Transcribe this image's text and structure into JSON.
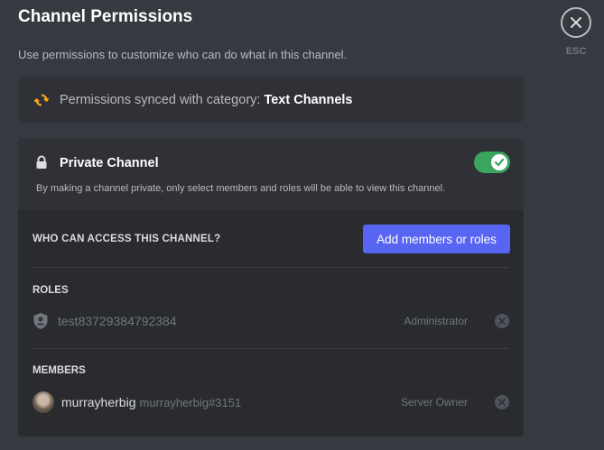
{
  "header": {
    "title": "Channel Permissions",
    "subtitle": "Use permissions to customize who can do what in this channel.",
    "esc_label": "ESC"
  },
  "sync": {
    "prefix": "Permissions synced with category: ",
    "category": "Text Channels",
    "icon": "sync-icon",
    "icon_color": "#faa61a"
  },
  "private_channel": {
    "title": "Private Channel",
    "description": "By making a channel private, only select members and roles will be able to view this channel.",
    "enabled": true,
    "toggle_color": "#3ba55d"
  },
  "access": {
    "heading": "WHO CAN ACCESS THIS CHANNEL?",
    "add_button": "Add members or roles",
    "accent": "#5865f2"
  },
  "roles": {
    "label": "ROLES",
    "items": [
      {
        "name": "test83729384792384",
        "tag": "Administrator"
      }
    ]
  },
  "members": {
    "label": "MEMBERS",
    "items": [
      {
        "name": "murrayherbig",
        "discriminator": "murrayherbig#3151",
        "tag": "Server Owner"
      }
    ]
  }
}
